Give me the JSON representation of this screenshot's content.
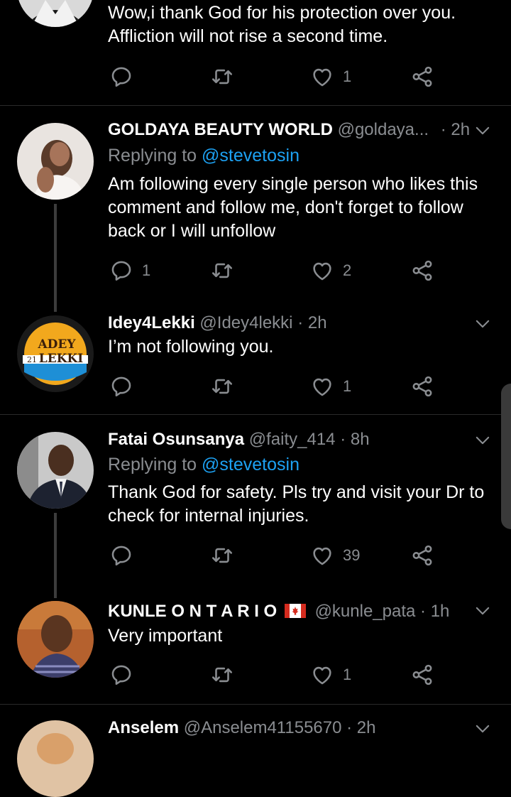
{
  "tweets": [
    {
      "name": "",
      "handle": "",
      "time": "",
      "replying_to": "",
      "text_lines": [
        "Wow,i thank God for his protection over you.",
        "Affliction will not rise a second time."
      ],
      "replies": "",
      "likes": "1"
    },
    {
      "name": "GOLDAYA BEAUTY WORLD",
      "handle": "@goldaya...",
      "time": "· 2h",
      "replying_label": "Replying to",
      "replying_to": "@stevetosin",
      "text_lines": [
        "Am following every single person who likes this",
        "comment and follow me, don't forget to follow",
        "back or I will unfollow"
      ],
      "replies": "1",
      "likes": "2"
    },
    {
      "name": "Idey4Lekki",
      "handle": "@Idey4lekki",
      "time": "· 2h",
      "text_lines": [
        "I’m not following you."
      ],
      "replies": "",
      "likes": "1",
      "avatar_text": [
        "ADEY",
        "21",
        "LEKKI"
      ]
    },
    {
      "name": "Fatai Osunsanya",
      "handle": "@faity_414",
      "time": "· 8h",
      "replying_label": "Replying to",
      "replying_to": "@stevetosin",
      "text_lines": [
        "Thank God for safety. Pls try and visit your Dr to",
        "check for internal injuries."
      ],
      "replies": "",
      "likes": "39"
    },
    {
      "name": "KUNLE O N T A R I O",
      "handle": "@kunle_pata",
      "time": "· 1h",
      "text_lines": [
        "Very important"
      ],
      "replies": "",
      "likes": "1"
    },
    {
      "name": "Anselem",
      "handle": "@Anselem41155670",
      "time": "· 2h",
      "text_lines": [],
      "replies": "",
      "likes": ""
    }
  ],
  "icons": {
    "reply": "reply-icon",
    "retweet": "retweet-icon",
    "like": "heart-icon",
    "share": "share-icon",
    "more": "chevron-down-icon",
    "flag": "canada-flag-icon"
  },
  "colors": {
    "background": "#000000",
    "text": "#ffffff",
    "muted": "#8a8d91",
    "link": "#1da1f2"
  }
}
